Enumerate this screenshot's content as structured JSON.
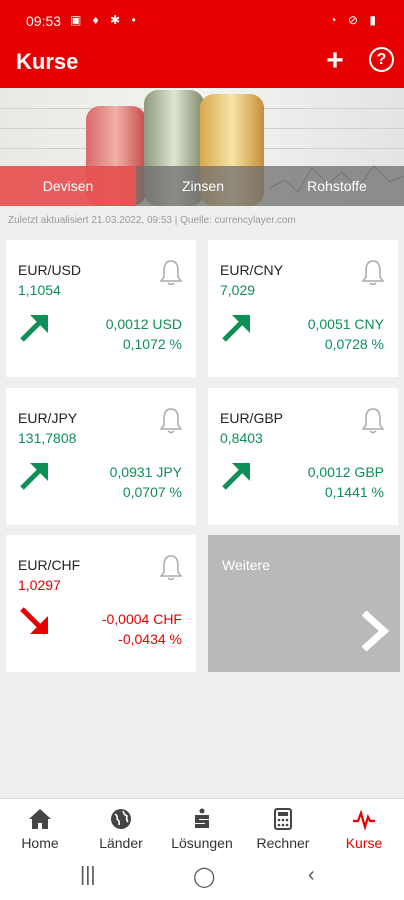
{
  "status": {
    "time": "09:53"
  },
  "appbar": {
    "title": "Kurse",
    "add_label": "+",
    "help_label": "?"
  },
  "tabs": [
    "Devisen",
    "Zinsen",
    "Rohstoffe"
  ],
  "updated": "Zuletzt aktualisiert 21.03.2022, 09:53 | Quelle: currencylayer.com",
  "cards": [
    {
      "pair": "EUR/USD",
      "rate": "1,1054",
      "change": "0,0012 USD",
      "percent": "0,1072 %",
      "direction": "up"
    },
    {
      "pair": "EUR/CNY",
      "rate": "7,029",
      "change": "0,0051 CNY",
      "percent": "0,0728 %",
      "direction": "up"
    },
    {
      "pair": "EUR/JPY",
      "rate": "131,7808",
      "change": "0,0931 JPY",
      "percent": "0,0707 %",
      "direction": "up"
    },
    {
      "pair": "EUR/GBP",
      "rate": "0,8403",
      "change": "0,0012 GBP",
      "percent": "0,1441 %",
      "direction": "up"
    },
    {
      "pair": "EUR/CHF",
      "rate": "1,0297",
      "change": "-0,0004 CHF",
      "percent": "-0,0434 %",
      "direction": "down"
    }
  ],
  "more": {
    "label": "Weitere"
  },
  "nav": [
    {
      "label": "Home",
      "icon": "home-icon"
    },
    {
      "label": "Länder",
      "icon": "globe-icon"
    },
    {
      "label": "Lösungen",
      "icon": "sparkasse-icon"
    },
    {
      "label": "Rechner",
      "icon": "calculator-icon"
    },
    {
      "label": "Kurse",
      "icon": "chart-pulse-icon"
    }
  ],
  "colors": {
    "brand": "#e60000",
    "up": "#0e8f57",
    "down": "#e60000"
  }
}
